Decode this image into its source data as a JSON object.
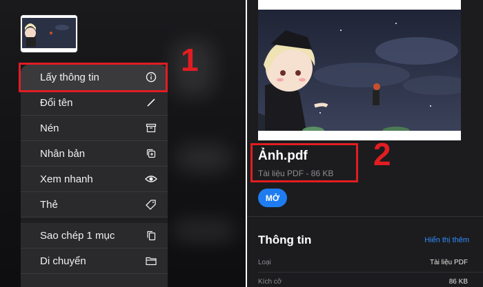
{
  "menu": {
    "items": [
      {
        "label": "Lấy thông tin",
        "icon": "info-icon"
      },
      {
        "label": "Đổi tên",
        "icon": "pencil-icon"
      },
      {
        "label": "Nén",
        "icon": "archive-icon"
      },
      {
        "label": "Nhân bản",
        "icon": "duplicate-icon"
      },
      {
        "label": "Xem nhanh",
        "icon": "eye-icon"
      },
      {
        "label": "Thẻ",
        "icon": "tag-icon"
      },
      {
        "label": "Sao chép 1 mục",
        "icon": "copy-icon"
      },
      {
        "label": "Di chuyển",
        "icon": "folder-icon"
      }
    ]
  },
  "annotations": {
    "step1": "1",
    "step2": "2",
    "color": "#e11d22"
  },
  "file": {
    "name": "Ảnh.pdf",
    "meta": "Tài liệu PDF - 86 KB",
    "open_label": "MỞ"
  },
  "info": {
    "title": "Thông tin",
    "more_link": "Hiển thị thêm",
    "rows": [
      {
        "label": "Loại",
        "value": "Tài liệu PDF"
      },
      {
        "label": "Kích cỡ",
        "value": "86 KB"
      }
    ]
  },
  "colors": {
    "accent": "#1e7cf0",
    "link": "#2f8cff",
    "menu_bg": "#2a2a2d",
    "panel_bg": "#1c1c1e"
  }
}
